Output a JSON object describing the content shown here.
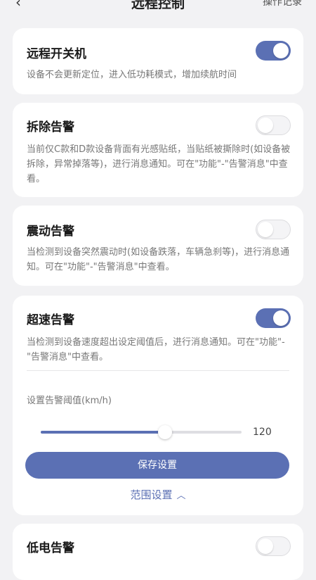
{
  "header": {
    "back_icon": "chevron-left-icon",
    "title": "远程控制",
    "right_text": "操作记录"
  },
  "cards": {
    "remote_power": {
      "title": "远程开关机",
      "desc": "设备不会更新定位，进入低功耗模式，增加续航时间",
      "enabled": true
    },
    "tamper_alarm": {
      "title": "拆除告警",
      "desc": "当前仅C款和D款设备背面有光感贴纸，当贴纸被撕除时(如设备被拆除，异常掉落等)，进行消息通知。可在\"功能\"-\"告警消息\"中查看。",
      "enabled": false
    },
    "vibration_alarm": {
      "title": "震动告警",
      "desc": "当检测到设备突然震动时(如设备跌落，车辆急刹等)，进行消息通知。可在\"功能\"-\"告警消息\"中查看。",
      "enabled": false
    },
    "speed_alarm": {
      "title": "超速告警",
      "desc": "当检测到设备速度超出设定阈值后，进行消息通知。可在\"功能\"-\"告警消息\"中查看。",
      "enabled": true,
      "threshold_label": "设置告警阈值(km/h)",
      "threshold_value": "120",
      "slider_fraction": 0.62,
      "save_label": "保存设置",
      "range_label": "范围设置",
      "range_icon": "chevron-up-icon"
    },
    "low_battery_alarm": {
      "title": "低电告警",
      "enabled": false
    }
  },
  "colors": {
    "accent": "#5b70b4",
    "background": "#f2f2f4",
    "card": "#ffffff"
  }
}
